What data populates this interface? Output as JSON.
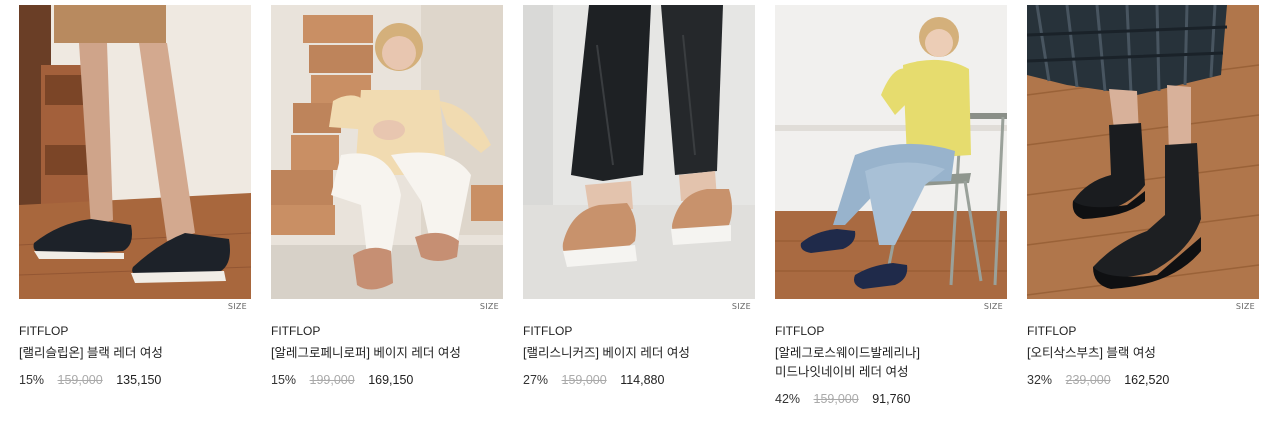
{
  "products": [
    {
      "brand": "FITFLOP",
      "name": "[랠리슬립온] 블랙 레더 여성",
      "discount": "15%",
      "original_price": "159,000",
      "sale_price": "135,150",
      "size_label": "SIZE",
      "image_desc": "black leather slip-on sneakers on wooden floor"
    },
    {
      "brand": "FITFLOP",
      "name": "[알레그로페니로퍼] 베이지 레더 여성",
      "discount": "15%",
      "original_price": "199,000",
      "sale_price": "169,150",
      "size_label": "SIZE",
      "image_desc": "model sitting with beige leather penny loafers among boxes"
    },
    {
      "brand": "FITFLOP",
      "name": "[랠리스니커즈] 베이지 레더 여성",
      "discount": "27%",
      "original_price": "159,000",
      "sale_price": "114,880",
      "size_label": "SIZE",
      "image_desc": "beige leather lace-up sneakers with black pants"
    },
    {
      "brand": "FITFLOP",
      "name": "[알레그로스웨이드발레리나] 미드나잇네이비 레더 여성",
      "discount": "42%",
      "original_price": "159,000",
      "sale_price": "91,760",
      "size_label": "SIZE",
      "image_desc": "model in yellow cardigan on folding chair wearing navy suede flats"
    },
    {
      "brand": "FITFLOP",
      "name": "[오티삭스부츠] 블랙 여성",
      "discount": "32%",
      "original_price": "239,000",
      "sale_price": "162,520",
      "size_label": "SIZE",
      "image_desc": "black sock ankle boots with plaid skirt on wooden floor"
    }
  ]
}
